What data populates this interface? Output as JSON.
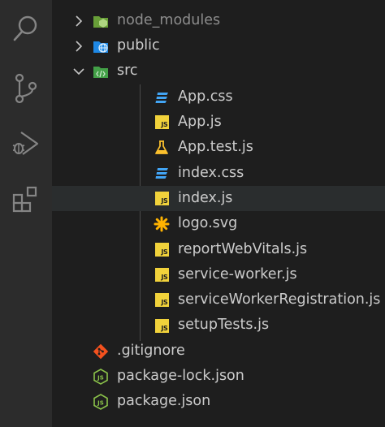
{
  "activity_bar": {
    "items": [
      {
        "icon": "search-icon"
      },
      {
        "icon": "source-control-icon"
      },
      {
        "icon": "run-debug-icon"
      },
      {
        "icon": "extensions-icon"
      }
    ]
  },
  "explorer": {
    "items": [
      {
        "label": "node_modules",
        "type": "folder",
        "state": "collapsed",
        "icon": "node-folder-icon"
      },
      {
        "label": "public",
        "type": "folder",
        "state": "collapsed",
        "icon": "public-folder-icon"
      },
      {
        "label": "src",
        "type": "folder",
        "state": "expanded",
        "icon": "src-folder-icon"
      },
      {
        "label": "App.css",
        "type": "file",
        "icon": "css-file-icon"
      },
      {
        "label": "App.js",
        "type": "file",
        "icon": "js-file-icon"
      },
      {
        "label": "App.test.js",
        "type": "file",
        "icon": "test-file-icon"
      },
      {
        "label": "index.css",
        "type": "file",
        "icon": "css-file-icon"
      },
      {
        "label": "index.js",
        "type": "file",
        "icon": "js-file-icon",
        "hovered": true
      },
      {
        "label": "logo.svg",
        "type": "file",
        "icon": "svg-file-icon"
      },
      {
        "label": "reportWebVitals.js",
        "type": "file",
        "icon": "js-file-icon"
      },
      {
        "label": "service-worker.js",
        "type": "file",
        "icon": "js-file-icon"
      },
      {
        "label": "serviceWorkerRegistration.js",
        "type": "file",
        "icon": "js-file-icon"
      },
      {
        "label": "setupTests.js",
        "type": "file",
        "icon": "js-file-icon"
      },
      {
        "label": ".gitignore",
        "type": "file",
        "icon": "git-file-icon"
      },
      {
        "label": "package-lock.json",
        "type": "file",
        "icon": "node-json-file-icon"
      },
      {
        "label": "package.json",
        "type": "file",
        "icon": "node-json-file-icon"
      }
    ],
    "js_badge_text": "JS"
  },
  "colors": {
    "activity_bar_bg": "#2c2c2c",
    "sidebar_bg": "#1e1e1e",
    "hover_bg": "#2a2d2e",
    "text": "#cccccc",
    "dim_text": "#8c8c8c",
    "js_yellow": "#f1d23b",
    "css_blue": "#42a5f5",
    "node_green": "#8bc34a",
    "git_orange": "#f4511e"
  }
}
